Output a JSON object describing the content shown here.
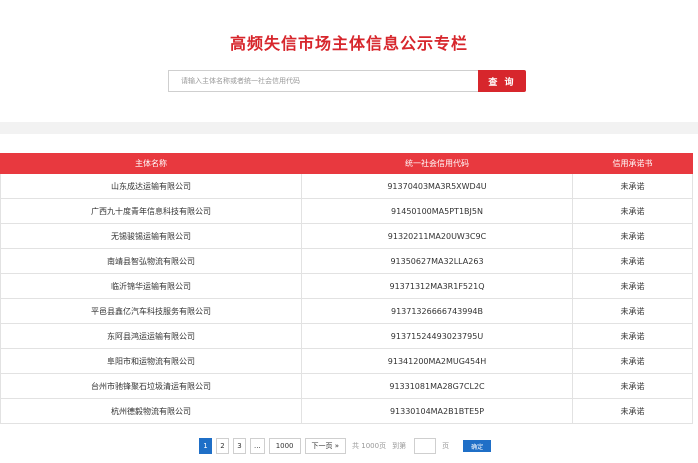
{
  "header": {
    "title": "高频失信市场主体信息公示专栏"
  },
  "search": {
    "placeholder": "请输入主体名称或者统一社会信用代码",
    "button_label": "查 询"
  },
  "table": {
    "columns": [
      "主体名称",
      "统一社会信用代码",
      "信用承诺书"
    ],
    "rows": [
      {
        "name": "山东成达运输有限公司",
        "code": "91370403MA3R5XWD4U",
        "status": "未承诺"
      },
      {
        "name": "广西九十度青年信息科技有限公司",
        "code": "91450100MA5PT1BJ5N",
        "status": "未承诺"
      },
      {
        "name": "无锡骏锡运输有限公司",
        "code": "91320211MA20UW3C9C",
        "status": "未承诺"
      },
      {
        "name": "南靖县智弘物流有限公司",
        "code": "91350627MA32LLA263",
        "status": "未承诺"
      },
      {
        "name": "临沂锦华运输有限公司",
        "code": "91371312MA3R1F521Q",
        "status": "未承诺"
      },
      {
        "name": "平邑县鑫亿汽车科技服务有限公司",
        "code": "91371326666743994B",
        "status": "未承诺"
      },
      {
        "name": "东阿县鸿运运输有限公司",
        "code": "91371524493023795U",
        "status": "未承诺"
      },
      {
        "name": "阜阳市和运物流有限公司",
        "code": "91341200MA2MUG454H",
        "status": "未承诺"
      },
      {
        "name": "台州市驰锋聚石垃圾清运有限公司",
        "code": "91331081MA28G7CL2C",
        "status": "未承诺"
      },
      {
        "name": "杭州德毅物流有限公司",
        "code": "91330104MA2B1BTE5P",
        "status": "未承诺"
      }
    ]
  },
  "pagination": {
    "pages": [
      "1",
      "2",
      "3"
    ],
    "ellipsis": "...",
    "last_page": "1000",
    "next_label": "下一页 »",
    "total_label": "共 1000页",
    "goto_label": "到第",
    "page_suffix": "页",
    "confirm_label": "确定"
  }
}
